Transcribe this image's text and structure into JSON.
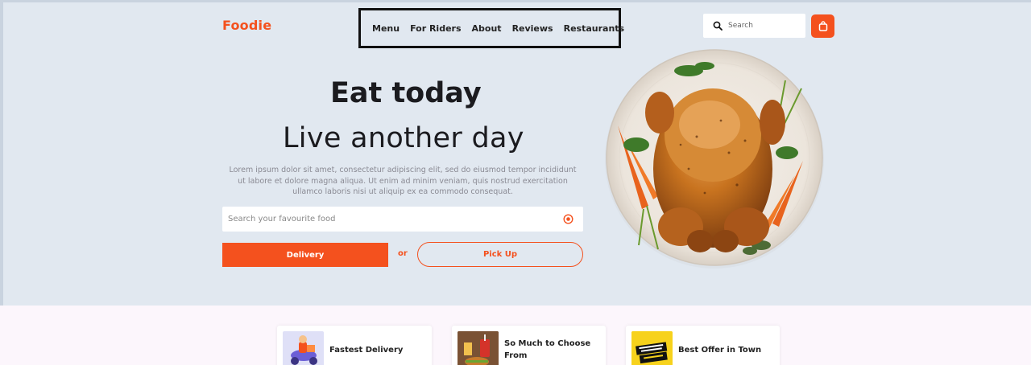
{
  "brand": {
    "name": "Foodie",
    "accent": "#f4511e"
  },
  "nav": {
    "items": [
      "Menu",
      "For Riders",
      "About",
      "Reviews",
      "Restaurants"
    ]
  },
  "header_search": {
    "placeholder": "Search",
    "icon": "search-icon"
  },
  "cart": {
    "icon": "shopping-bag-icon"
  },
  "hero": {
    "title": "Eat today",
    "subtitle": "Live another day",
    "lead": "Lorem ipsum dolor sit amet, consectetur adipiscing elit, sed do eiusmod tempor incididunt ut labore et dolore magna aliqua. Ut enim ad minim veniam, quis nostrud exercitation ullamco laboris nisi ut aliquip ex ea commodo consequat.",
    "food_search_placeholder": "Search your favourite food",
    "location_icon": "target-icon",
    "delivery_label": "Delivery",
    "or_label": "or",
    "pickup_label": "Pick Up",
    "image": "roast-chicken-plate"
  },
  "features": [
    {
      "label": "Fastest Delivery",
      "icon": "scooter-rider-icon"
    },
    {
      "label": "So Much to Choose From",
      "icon": "burger-drink-icon"
    },
    {
      "label": "Best Offer in Town",
      "icon": "special-offer-icon"
    }
  ]
}
